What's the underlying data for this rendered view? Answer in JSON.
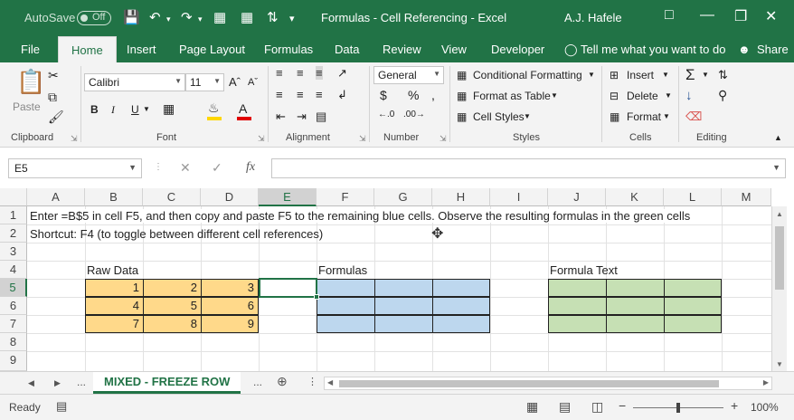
{
  "titlebar": {
    "autosave_label": "AutoSave",
    "autosave_state": "Off",
    "doc_title": "Formulas - Cell Referencing  -  Excel",
    "user": "A.J. Hafele"
  },
  "tabs": [
    "File",
    "Home",
    "Insert",
    "Page Layout",
    "Formulas",
    "Data",
    "Review",
    "View",
    "Developer"
  ],
  "tell_me": "Tell me what you want to do",
  "share": "Share",
  "ribbon": {
    "groups": [
      "Clipboard",
      "Font",
      "Alignment",
      "Number",
      "Styles",
      "Cells",
      "Editing"
    ],
    "paste": "Paste",
    "font_name": "Calibri",
    "font_size": "11",
    "number_format": "General",
    "conditional_formatting": "Conditional Formatting",
    "format_as_table": "Format as Table",
    "cell_styles": "Cell Styles",
    "insert": "Insert",
    "delete": "Delete",
    "format": "Format"
  },
  "formula_bar": {
    "name_box": "E5",
    "fx": "fx",
    "value": ""
  },
  "grid": {
    "columns": [
      "A",
      "B",
      "C",
      "D",
      "E",
      "F",
      "G",
      "H",
      "I",
      "J",
      "K",
      "L",
      "M"
    ],
    "selected_column": "E",
    "rows": [
      "1",
      "2",
      "3",
      "4",
      "5",
      "6",
      "7",
      "8",
      "9"
    ],
    "selected_row": "5",
    "row1_text": "Enter =B$5 in cell F5, and then copy and paste F5 to the remaining blue cells.  Observe the resulting formulas in the green cells",
    "row2_text": "Shortcut: F4 (to toggle between different cell references)",
    "raw_data_label": "Raw Data",
    "formulas_label": "Formulas",
    "formula_text_label": "Formula Text",
    "raw_data": [
      [
        "1",
        "2",
        "3"
      ],
      [
        "4",
        "5",
        "6"
      ],
      [
        "7",
        "8",
        "9"
      ]
    ]
  },
  "sheets": {
    "active": "MIXED - FREEZE ROW",
    "more_left": "...",
    "more_right": "..."
  },
  "status": {
    "ready": "Ready",
    "zoom": "100%"
  }
}
